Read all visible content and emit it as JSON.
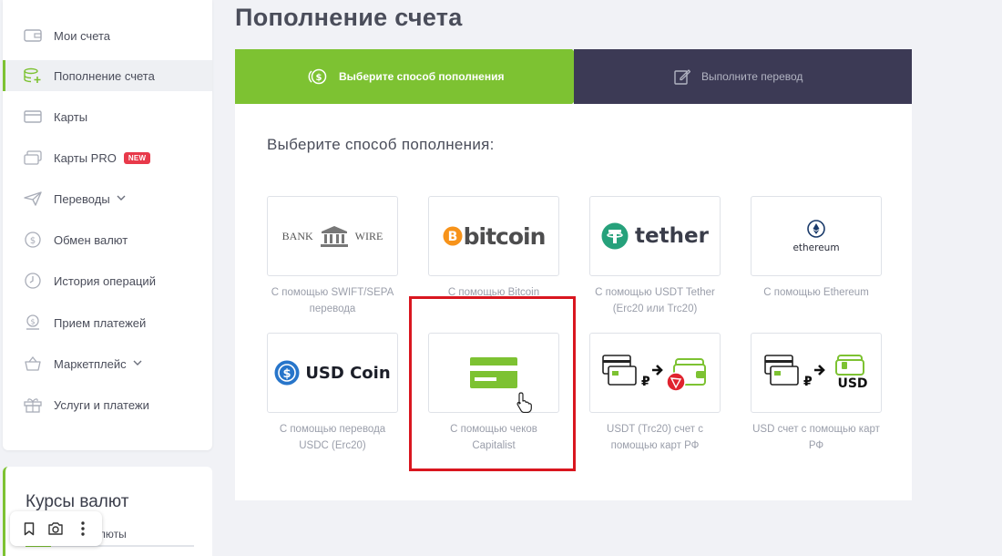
{
  "sidebar": {
    "items": [
      {
        "label": "Мои счета",
        "icon": "wallet-icon"
      },
      {
        "label": "Пополнение счета",
        "icon": "deposit-icon",
        "active": true
      },
      {
        "label": "Карты",
        "icon": "card-icon"
      },
      {
        "label": "Карты PRO",
        "icon": "card-pro-icon",
        "badge": "NEW"
      },
      {
        "label": "Переводы",
        "icon": "send-icon",
        "has_dropdown": true
      },
      {
        "label": "Обмен валют",
        "icon": "exchange-icon"
      },
      {
        "label": "История операций",
        "icon": "history-icon"
      },
      {
        "label": "Прием платежей",
        "icon": "payments-icon"
      },
      {
        "label": "Маркетплейс",
        "icon": "basket-icon",
        "has_dropdown": true
      },
      {
        "label": "Услуги и платежи",
        "icon": "gift-icon"
      }
    ]
  },
  "rates": {
    "title": "Курсы валют",
    "subtitle": "валюты"
  },
  "page": {
    "title": "Пополнение счета"
  },
  "stepper": {
    "step1": "Выберите способ пополнения",
    "step2": "Выполните перевод"
  },
  "panel": {
    "heading": "Выберите способ пополнения:"
  },
  "methods": [
    {
      "logo_text_left": "BANK",
      "logo_text_right": "WIRE",
      "caption": "С помощью SWIFT/SEPA перевода"
    },
    {
      "logo_text": "bitcoin",
      "caption": "С помощью Bitcoin"
    },
    {
      "logo_text": "tether",
      "caption": "С помощью USDT Tether (Erc20 или Trc20)"
    },
    {
      "logo_text": "ethereum",
      "caption": "С помощью Ethereum"
    },
    {
      "logo_text": "USD Coin",
      "caption": "С помощью перевода USDC (Erc20)"
    },
    {
      "caption": "С помощью чеков Capitalist",
      "highlighted": true
    },
    {
      "caption": "USDT (Trc20) счет с помощью карт РФ"
    },
    {
      "logo_text": "USD",
      "caption": "USD счет с помощью карт РФ"
    }
  ],
  "colors": {
    "accent_green": "#7dc232",
    "stepper_dark": "#3c3a55",
    "badge_red": "#e8394a",
    "highlight_red": "#d9161f",
    "bitcoin_orange": "#f7931a",
    "tether_teal": "#26a17b",
    "usdc_blue": "#2775ca"
  }
}
